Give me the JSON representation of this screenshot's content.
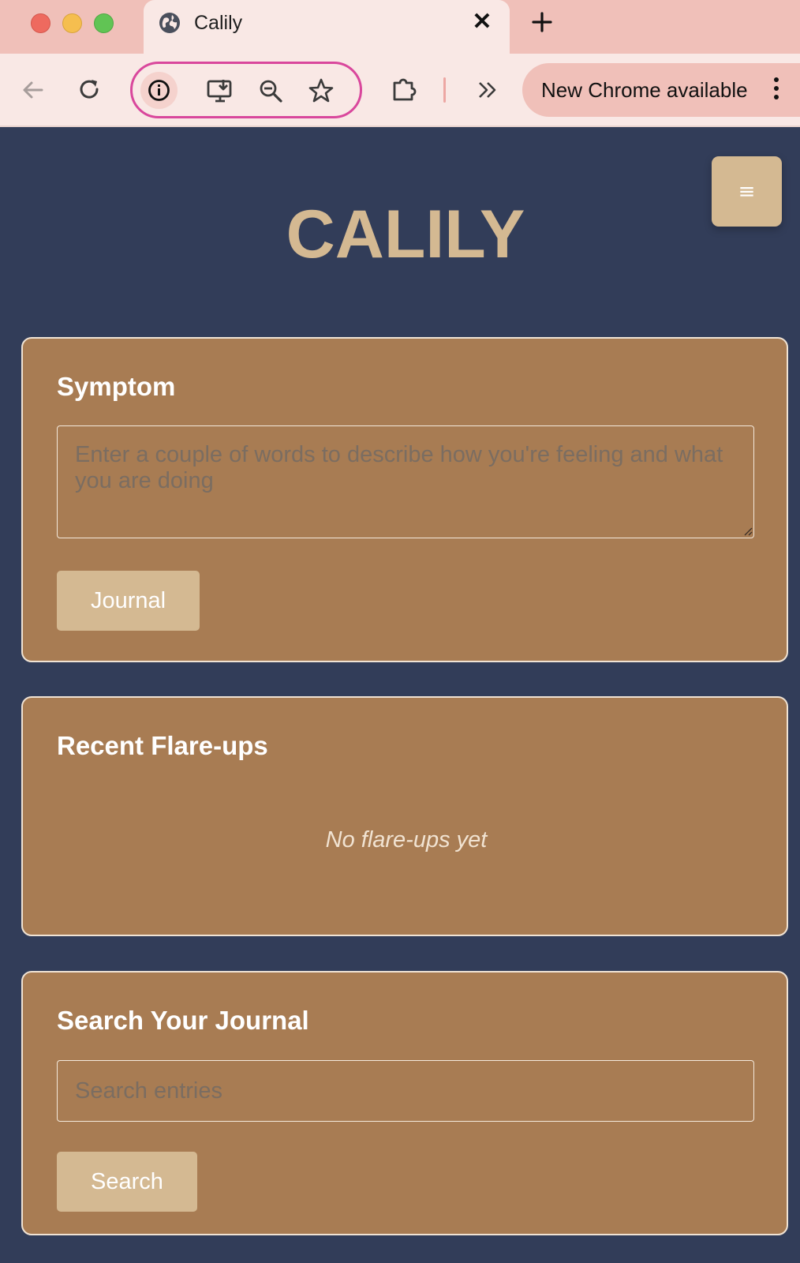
{
  "browser": {
    "tab": {
      "title": "Calily",
      "close_label": "✕"
    },
    "update_pill": {
      "label": "New Chrome available"
    },
    "icons": {
      "favicon": "globe-icon",
      "new_tab": "plus-icon",
      "back": "arrow-left-icon",
      "reload": "reload-icon",
      "site_info": "info-icon",
      "install": "install-app-icon",
      "zoom": "zoom-out-icon",
      "bookmark": "star-icon",
      "extensions": "puzzle-icon",
      "overflow": "chevron-double-right-icon",
      "menu": "kebab-menu-icon"
    }
  },
  "app": {
    "title": "CALILY",
    "menu_button_label": "≡"
  },
  "symptom_card": {
    "title": "Symptom",
    "textarea_value": "",
    "textarea_placeholder": "Enter a couple of words to describe how you're feeling and what you are doing",
    "button_label": "Journal"
  },
  "flare_card": {
    "title": "Recent Flare-ups",
    "empty_text": "No flare-ups yet"
  },
  "search_card": {
    "title": "Search Your Journal",
    "input_value": "",
    "input_placeholder": "Search entries",
    "button_label": "Search"
  },
  "colors": {
    "page_background": "#323d59",
    "card_background": "#a87c53",
    "accent": "#d4b992",
    "chrome_tabbar": "#f0c0b9",
    "chrome_toolbar": "#f9e8e5",
    "omnibox_highlight": "#d9479c"
  }
}
